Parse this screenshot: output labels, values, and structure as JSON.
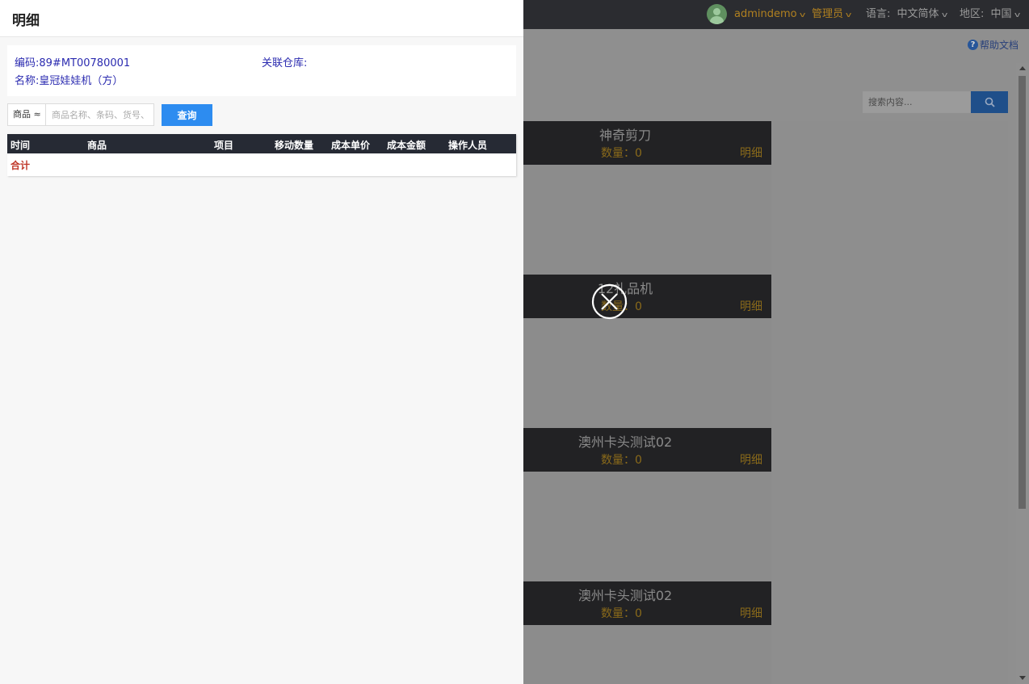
{
  "topbar": {
    "username": "admindemo",
    "role": "管理员",
    "language_label": "语言:",
    "language_value": "中文简体",
    "region_label": "地区:",
    "region_value": "中国"
  },
  "help": {
    "label": "帮助文档",
    "icon_text": "?"
  },
  "search": {
    "placeholder": "搜索内容..."
  },
  "cards": [
    {
      "name": "神奇剪刀",
      "qty": "数量：0",
      "detail": "明细"
    },
    {
      "name": "12礼品机",
      "qty": "数量：0",
      "detail": "明细"
    },
    {
      "name": "澳州卡头测试02",
      "qty": "数量：0",
      "detail": "明细"
    },
    {
      "name": "澳州卡头测试02",
      "qty": "数量：0",
      "detail": "明细"
    }
  ],
  "panel": {
    "title": "明细",
    "code_label": "编码:",
    "code_value": "89#MT00780001",
    "warehouse_label": "关联仓库:",
    "name_label": "名称:",
    "name_value": "皇冠娃娃机（方）",
    "filter": {
      "select_value": "商品 ≈",
      "placeholder": "商品名称、条码、货号、"
    },
    "query_button": "查询",
    "table": {
      "columns": [
        "时间",
        "商品",
        "项目",
        "移动数量",
        "成本单价",
        "成本金额",
        "操作人员"
      ],
      "total_label": "合计"
    }
  },
  "colors": {
    "accent": "#2d8cf0",
    "topbar_bg": "#2b2c30",
    "table_header_bg": "#262a34",
    "total_text": "#c0392b",
    "info_text": "#2b2bb0"
  }
}
